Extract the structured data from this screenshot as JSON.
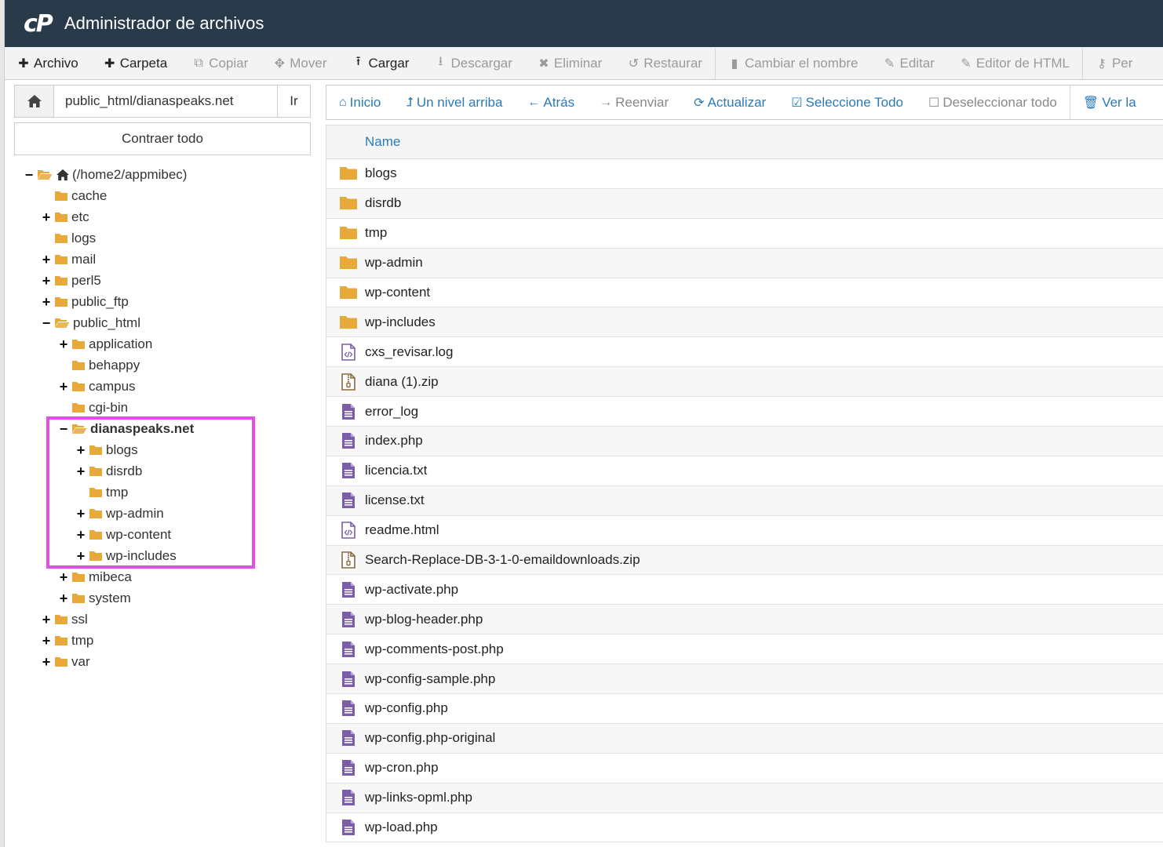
{
  "app": {
    "logo": "cP",
    "title": "Administrador de archivos"
  },
  "toolbar": [
    {
      "label": "Archivo",
      "icon": "plus-icon",
      "glyph": "✚",
      "enabled": true
    },
    {
      "label": "Carpeta",
      "icon": "plus-icon",
      "glyph": "✚",
      "enabled": true
    },
    {
      "label": "Copiar",
      "icon": "copy-icon",
      "glyph": "⧉",
      "enabled": false
    },
    {
      "label": "Mover",
      "icon": "move-icon",
      "glyph": "✥",
      "enabled": false
    },
    {
      "label": "Cargar",
      "icon": "upload-icon",
      "glyph": "⭱",
      "enabled": true
    },
    {
      "label": "Descargar",
      "icon": "download-icon",
      "glyph": "⭳",
      "enabled": false
    },
    {
      "label": "Eliminar",
      "icon": "delete-icon",
      "glyph": "✖",
      "enabled": false
    },
    {
      "label": "Restaurar",
      "icon": "restore-icon",
      "glyph": "↺",
      "enabled": false
    },
    {
      "label": "Cambiar el nombre",
      "icon": "file-icon",
      "glyph": "▮",
      "enabled": false
    },
    {
      "label": "Editar",
      "icon": "pencil-icon",
      "glyph": "✎",
      "enabled": false
    },
    {
      "label": "Editor de HTML",
      "icon": "html-editor-icon",
      "glyph": "✎",
      "enabled": false
    },
    {
      "label": "Per",
      "icon": "key-icon",
      "glyph": "⚷",
      "enabled": false
    }
  ],
  "path_bar": {
    "value": "public_html/dianaspeaks.net",
    "go_label": "Ir"
  },
  "collapse_label": "Contraer todo",
  "tree": [
    {
      "label": "(/home2/appmibec)",
      "depth": 0,
      "toggle": "−",
      "open": true,
      "home": true
    },
    {
      "label": "cache",
      "depth": 1,
      "toggle": ""
    },
    {
      "label": "etc",
      "depth": 1,
      "toggle": "+"
    },
    {
      "label": "logs",
      "depth": 1,
      "toggle": ""
    },
    {
      "label": "mail",
      "depth": 1,
      "toggle": "+"
    },
    {
      "label": "perl5",
      "depth": 1,
      "toggle": "+"
    },
    {
      "label": "public_ftp",
      "depth": 1,
      "toggle": "+"
    },
    {
      "label": "public_html",
      "depth": 1,
      "toggle": "−",
      "open": true
    },
    {
      "label": "application",
      "depth": 2,
      "toggle": "+"
    },
    {
      "label": "behappy",
      "depth": 2,
      "toggle": ""
    },
    {
      "label": "campus",
      "depth": 2,
      "toggle": "+"
    },
    {
      "label": "cgi-bin",
      "depth": 2,
      "toggle": ""
    },
    {
      "label": "dianaspeaks.net",
      "depth": 2,
      "toggle": "−",
      "open": true,
      "selected": true
    },
    {
      "label": "blogs",
      "depth": 3,
      "toggle": "+"
    },
    {
      "label": "disrdb",
      "depth": 3,
      "toggle": "+"
    },
    {
      "label": "tmp",
      "depth": 3,
      "toggle": ""
    },
    {
      "label": "wp-admin",
      "depth": 3,
      "toggle": "+"
    },
    {
      "label": "wp-content",
      "depth": 3,
      "toggle": "+"
    },
    {
      "label": "wp-includes",
      "depth": 3,
      "toggle": "+"
    },
    {
      "label": "mibeca",
      "depth": 2,
      "toggle": "+"
    },
    {
      "label": "system",
      "depth": 2,
      "toggle": "+"
    },
    {
      "label": "ssl",
      "depth": 1,
      "toggle": "+"
    },
    {
      "label": "tmp",
      "depth": 1,
      "toggle": "+"
    },
    {
      "label": "var",
      "depth": 1,
      "toggle": "+"
    }
  ],
  "actions": [
    {
      "label": "Inicio",
      "icon": "home-icon",
      "glyph": "⌂",
      "enabled": true
    },
    {
      "label": "Un nivel arriba",
      "icon": "level-up-icon",
      "glyph": "⮥",
      "enabled": true
    },
    {
      "label": "Atrás",
      "icon": "arrow-left-icon",
      "glyph": "←",
      "enabled": true
    },
    {
      "label": "Reenviar",
      "icon": "arrow-right-icon",
      "glyph": "→",
      "enabled": false
    },
    {
      "label": "Actualizar",
      "icon": "refresh-icon",
      "glyph": "⟳",
      "enabled": true
    },
    {
      "label": "Seleccione Todo",
      "icon": "checkbox-checked-icon",
      "glyph": "☑",
      "enabled": true
    },
    {
      "label": "Deseleccionar todo",
      "icon": "checkbox-empty-icon",
      "glyph": "☐",
      "enabled": false
    },
    {
      "label": "Ver la",
      "icon": "trash-icon",
      "glyph": "🗑",
      "enabled": true
    }
  ],
  "table": {
    "column_name": "Name",
    "files": [
      {
        "name": "blogs",
        "type": "folder"
      },
      {
        "name": "disrdb",
        "type": "folder"
      },
      {
        "name": "tmp",
        "type": "folder"
      },
      {
        "name": "wp-admin",
        "type": "folder"
      },
      {
        "name": "wp-content",
        "type": "folder"
      },
      {
        "name": "wp-includes",
        "type": "folder"
      },
      {
        "name": "cxs_revisar.log",
        "type": "code"
      },
      {
        "name": "diana (1).zip",
        "type": "zip"
      },
      {
        "name": "error_log",
        "type": "text"
      },
      {
        "name": "index.php",
        "type": "text"
      },
      {
        "name": "licencia.txt",
        "type": "text"
      },
      {
        "name": "license.txt",
        "type": "text"
      },
      {
        "name": "readme.html",
        "type": "code"
      },
      {
        "name": "Search-Replace-DB-3-1-0-emaildownloads.zip",
        "type": "zip"
      },
      {
        "name": "wp-activate.php",
        "type": "text"
      },
      {
        "name": "wp-blog-header.php",
        "type": "text"
      },
      {
        "name": "wp-comments-post.php",
        "type": "text"
      },
      {
        "name": "wp-config-sample.php",
        "type": "text"
      },
      {
        "name": "wp-config.php",
        "type": "text"
      },
      {
        "name": "wp-config.php-original",
        "type": "text"
      },
      {
        "name": "wp-cron.php",
        "type": "text"
      },
      {
        "name": "wp-links-opml.php",
        "type": "text"
      },
      {
        "name": "wp-load.php",
        "type": "text"
      }
    ]
  },
  "colors": {
    "header_bg": "#293a4a",
    "link_blue": "#2a7ab8",
    "folder": "#e8a93b",
    "file_purple": "#7b5ea7",
    "highlight": "#e44fe8"
  }
}
